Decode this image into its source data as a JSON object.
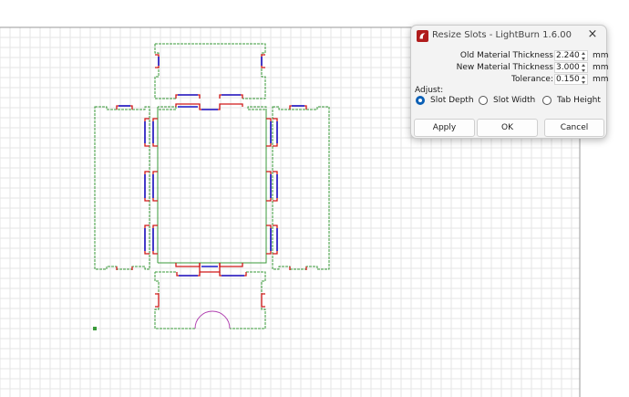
{
  "dialog": {
    "title": "Resize Slots - LightBurn 1.6.00",
    "app_icon": "lightburn-logo-icon",
    "close_icon": "close-icon",
    "close_glyph": "×",
    "fields": [
      {
        "label": "Old Material Thickness",
        "value": "2.240",
        "unit": "mm"
      },
      {
        "label": "New Material Thickness",
        "value": "3.000",
        "unit": "mm"
      },
      {
        "label": "Tolerance:",
        "value": "0.150",
        "unit": "mm"
      }
    ],
    "adjust_label": "Adjust:",
    "options": [
      {
        "label": "Slot Depth",
        "selected": true
      },
      {
        "label": "Slot Width",
        "selected": false
      },
      {
        "label": "Tab Height",
        "selected": false
      }
    ],
    "buttons": {
      "apply": "Apply",
      "ok": "OK",
      "cancel": "Cancel"
    }
  },
  "canvas": {
    "grid_color": "#e6e6e6",
    "outline_color": "#3a9a3a",
    "slot_color": "#d01818",
    "highlight_color": "#1a1acc",
    "arc_color": "#b040b0",
    "accent_color": "#0a5fb5"
  }
}
